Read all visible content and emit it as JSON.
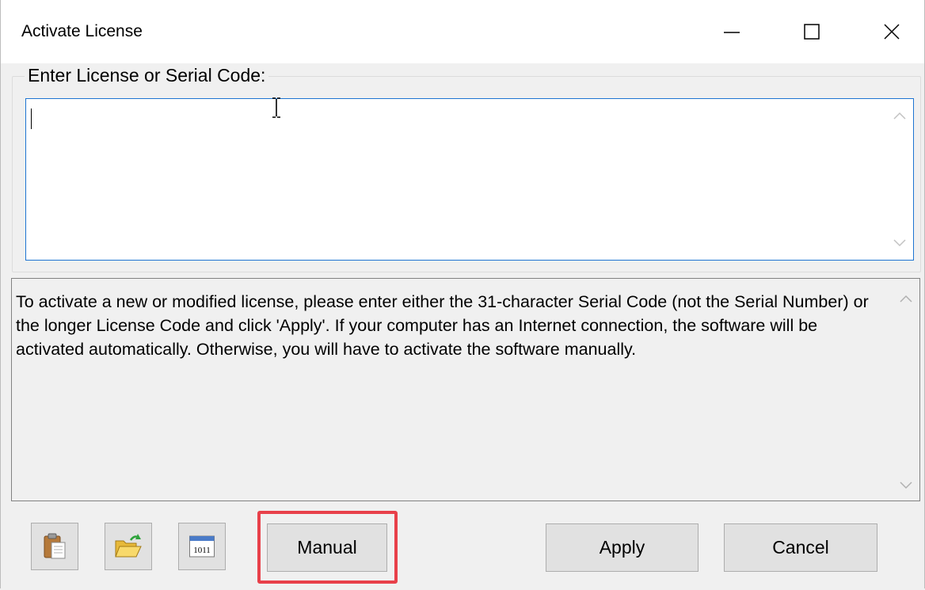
{
  "window": {
    "title": "Activate License"
  },
  "license_group": {
    "label": "Enter License or Serial Code:",
    "input_value": ""
  },
  "info": {
    "text": "To activate a new or modified license, please enter either the 31-character Serial Code (not the Serial Number) or the longer License Code and click 'Apply'.  If your computer has an Internet connection, the software will be activated automatically.  Otherwise, you will have to activate the software manually."
  },
  "toolbar": {
    "icons": [
      "paste-clipboard-icon",
      "open-file-icon",
      "binary-code-icon"
    ],
    "binary_icon_text": "1011"
  },
  "buttons": {
    "manual": "Manual",
    "apply": "Apply",
    "cancel": "Cancel"
  },
  "colors": {
    "focus_border": "#1e74d2",
    "highlight": "#e8404a",
    "button_face": "#e1e1e1"
  }
}
